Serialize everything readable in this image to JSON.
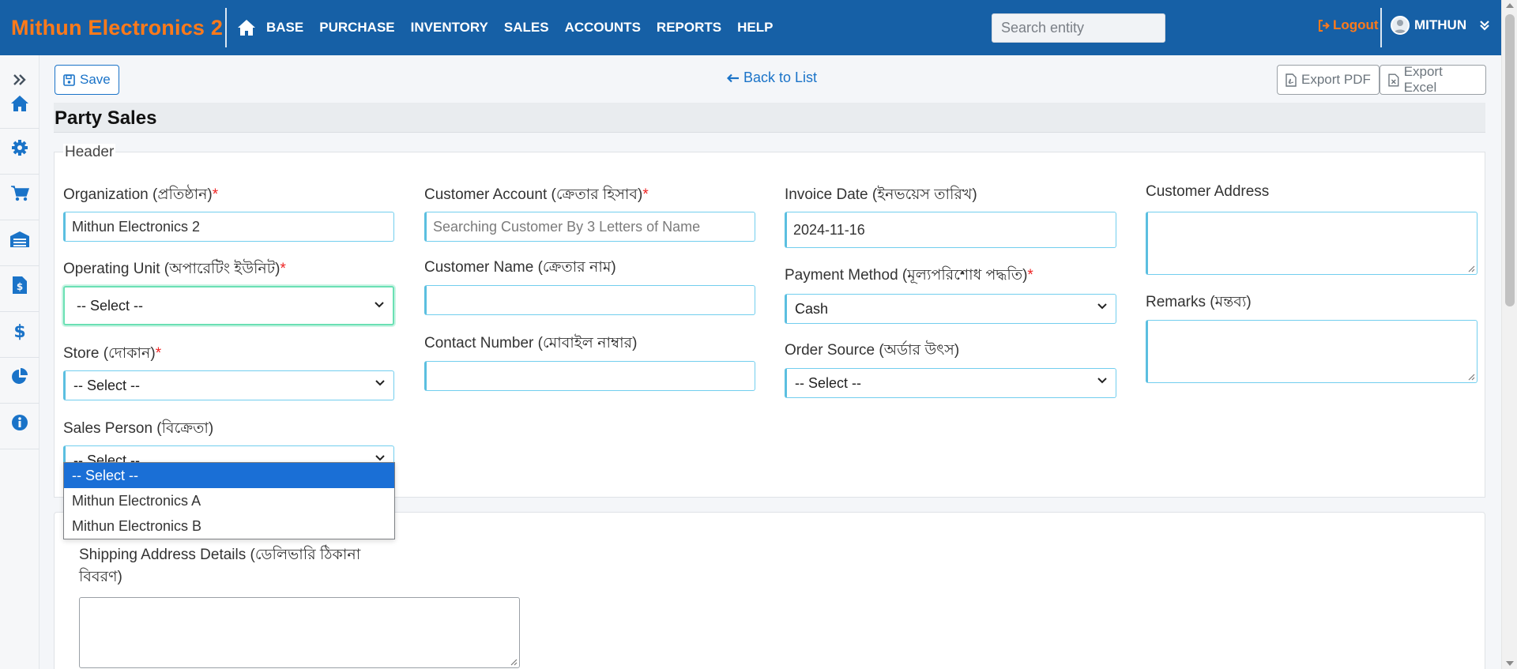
{
  "app": {
    "brand": "Mithun Electronics 2"
  },
  "nav": {
    "items": [
      "BASE",
      "PURCHASE",
      "INVENTORY",
      "SALES",
      "ACCOUNTS",
      "REPORTS",
      "HELP"
    ]
  },
  "search": {
    "placeholder": "Search entity"
  },
  "user": {
    "logout_label": "Logout",
    "name": "MITHUN"
  },
  "toolbar": {
    "save_label": "Save",
    "back_label": "Back to List",
    "export_pdf_label": "Export PDF",
    "export_excel_label": "Export Excel"
  },
  "page": {
    "title": "Party Sales"
  },
  "header_section": {
    "legend": "Header",
    "organization": {
      "label": "Organization (প্রতিষ্ঠান)",
      "value": "Mithun Electronics 2"
    },
    "operating_unit": {
      "label": "Operating Unit (অপারেটিং ইউনিট)",
      "value": "-- Select --"
    },
    "store": {
      "label": "Store (দোকান)",
      "value": "-- Select --"
    },
    "sales_person": {
      "label": "Sales Person (বিক্রেতা)",
      "value": "-- Select --",
      "options": [
        "-- Select --",
        "Mithun Electronics A",
        "Mithun Electronics B"
      ]
    },
    "customer_account": {
      "label": "Customer Account (ক্রেতার হিসাব)",
      "placeholder": "Searching Customer By 3 Letters of Name"
    },
    "customer_name": {
      "label": "Customer Name (ক্রেতার নাম)",
      "value": ""
    },
    "contact_number": {
      "label": "Contact Number (মোবাইল নাম্বার)",
      "value": ""
    },
    "invoice_date": {
      "label": "Invoice Date (ইনভয়েস তারিখ)",
      "value": "2024-11-16"
    },
    "payment_method": {
      "label": "Payment Method (মূল্যপরিশোধ পদ্ধতি)",
      "value": "Cash"
    },
    "order_source": {
      "label": "Order Source (অর্ডার উৎস)",
      "value": "-- Select --"
    },
    "customer_address": {
      "label": "Customer Address"
    },
    "remarks": {
      "label": "Remarks (মন্তব্য)"
    }
  },
  "shipping": {
    "label_line1": "Shipping Address Details (ডেলিভারি ঠিকানা",
    "label_line2": "বিবরণ)"
  },
  "required_mark": "*",
  "colors": {
    "topbar": "#1660a6",
    "brand": "#ff7a1a",
    "accent": "#1a73c8"
  }
}
